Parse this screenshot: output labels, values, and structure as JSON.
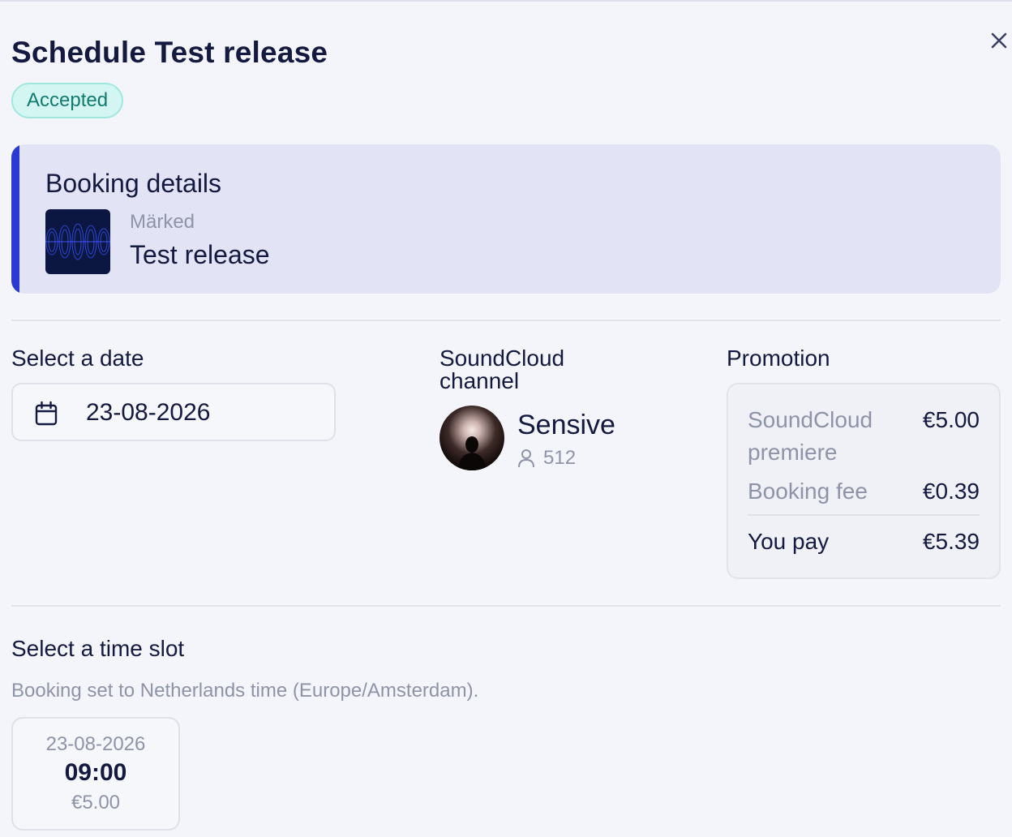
{
  "header": {
    "title": "Schedule Test release",
    "status": "Accepted"
  },
  "booking": {
    "heading": "Booking details",
    "artist": "Märked",
    "release": "Test release"
  },
  "date_section": {
    "label": "Select a date",
    "value": "23-08-2026"
  },
  "channel_section": {
    "label_line1": "SoundCloud",
    "label_line2": "channel",
    "name": "Sensive",
    "followers": "512"
  },
  "promotion": {
    "label": "Promotion",
    "items": [
      {
        "label_line1": "SoundCloud",
        "label_line2": "premiere",
        "amount": "€5.00"
      },
      {
        "label": "Booking fee",
        "amount": "€0.39"
      }
    ],
    "total_label": "You pay",
    "total_amount": "€5.39"
  },
  "time_slot": {
    "label": "Select a time slot",
    "note": "Booking set to Netherlands time (Europe/Amsterdam).",
    "slots": [
      {
        "date": "23-08-2026",
        "time": "09:00",
        "price": "€5.00"
      }
    ]
  },
  "colors": {
    "accent": "#2b3bd2",
    "badge_bg": "#d4f6f2",
    "badge_text": "#137a6f",
    "text": "#14193f",
    "muted": "#8f93a7"
  },
  "icons": {
    "close": "close-icon",
    "calendar": "calendar-icon",
    "user": "user-icon"
  }
}
